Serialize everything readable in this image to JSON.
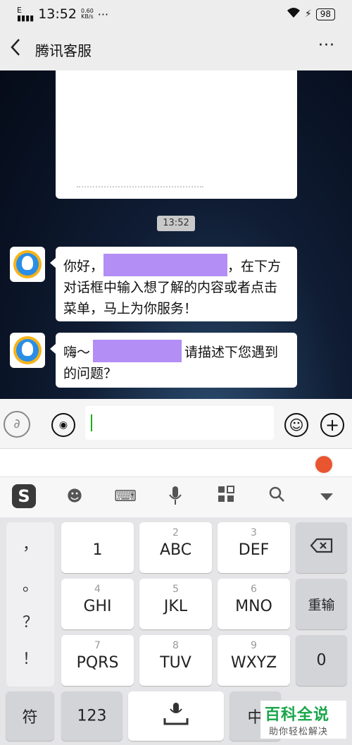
{
  "status_bar": {
    "signal": "E",
    "time": "13:52",
    "speed_value": "0.60",
    "speed_unit": "KB/s",
    "dots": "···",
    "battery": "98"
  },
  "nav": {
    "title": "腾讯客服",
    "more": "···"
  },
  "chat": {
    "timestamp": "13:52",
    "messages": [
      {
        "text_before": "你好，",
        "text_after": "，在下方对话框中输入想了解的内容或者点击菜单，马上为你服务！"
      },
      {
        "text_before": "嗨～",
        "text_after": "请描述下您遇到的问题？"
      }
    ]
  },
  "keyboard": {
    "punctuation": [
      "，",
      "。",
      "？",
      "！"
    ],
    "keys": [
      {
        "sub": "",
        "main": "1"
      },
      {
        "sub": "2",
        "main": "ABC"
      },
      {
        "sub": "3",
        "main": "DEF"
      },
      {
        "sub": "4",
        "main": "GHI"
      },
      {
        "sub": "5",
        "main": "JKL"
      },
      {
        "sub": "6",
        "main": "MNO"
      },
      {
        "sub": "7",
        "main": "PQRS"
      },
      {
        "sub": "8",
        "main": "TUV"
      },
      {
        "sub": "9",
        "main": "WXYZ"
      }
    ],
    "reenter": "重输",
    "zero": "0",
    "symbols": "符",
    "numbers": "123",
    "chinese": "中"
  },
  "watermark": {
    "title": "百科全说",
    "subtitle": "助你轻松解决"
  }
}
